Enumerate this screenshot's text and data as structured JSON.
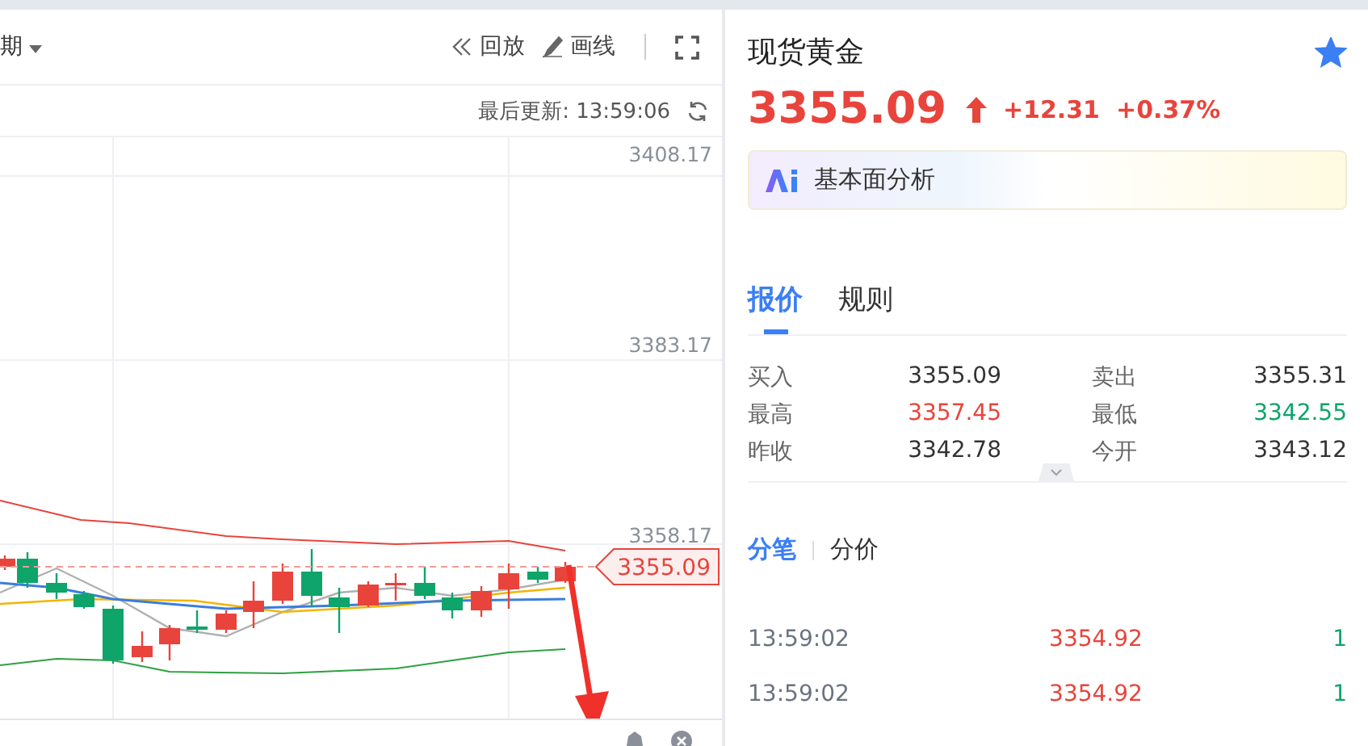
{
  "chart_panel": {
    "period_label": "期",
    "toolbar": [
      {
        "kind": "replay",
        "label": "回放"
      },
      {
        "kind": "draw",
        "label": "画线"
      },
      {
        "kind": "fullscreen"
      }
    ],
    "last_update": "最后更新: 13:59:06",
    "y_ticks": [
      "3408.17",
      "3383.17",
      "3358.17"
    ],
    "current_price_tag": "3355.09"
  },
  "quote": {
    "name": "现货黄金",
    "favorite": true,
    "price": "3355.09",
    "change": "+12.31",
    "change_pct": "+0.37%",
    "ai_label": "基本面分析",
    "tabs": [
      {
        "label": "报价",
        "selected": true
      },
      {
        "label": "规则",
        "selected": false
      }
    ],
    "stats": [
      {
        "label": "买入",
        "value": "3355.09",
        "color": "#333333"
      },
      {
        "label": "卖出",
        "value": "3355.31",
        "color": "#333333"
      },
      {
        "label": "最高",
        "value": "3357.45",
        "color": "#e8443c"
      },
      {
        "label": "最低",
        "value": "3342.55",
        "color": "#0ea46a"
      },
      {
        "label": "昨收",
        "value": "3342.78",
        "color": "#333333"
      },
      {
        "label": "今开",
        "value": "3343.12",
        "color": "#333333"
      }
    ],
    "trade_tabs": [
      {
        "label": "分笔",
        "selected": true
      },
      {
        "label": "分价",
        "selected": false
      }
    ],
    "ticks": [
      {
        "time": "13:59:02",
        "price": "3354.92",
        "volume": "1"
      },
      {
        "time": "13:59:02",
        "price": "3354.92",
        "volume": "1"
      }
    ]
  }
}
